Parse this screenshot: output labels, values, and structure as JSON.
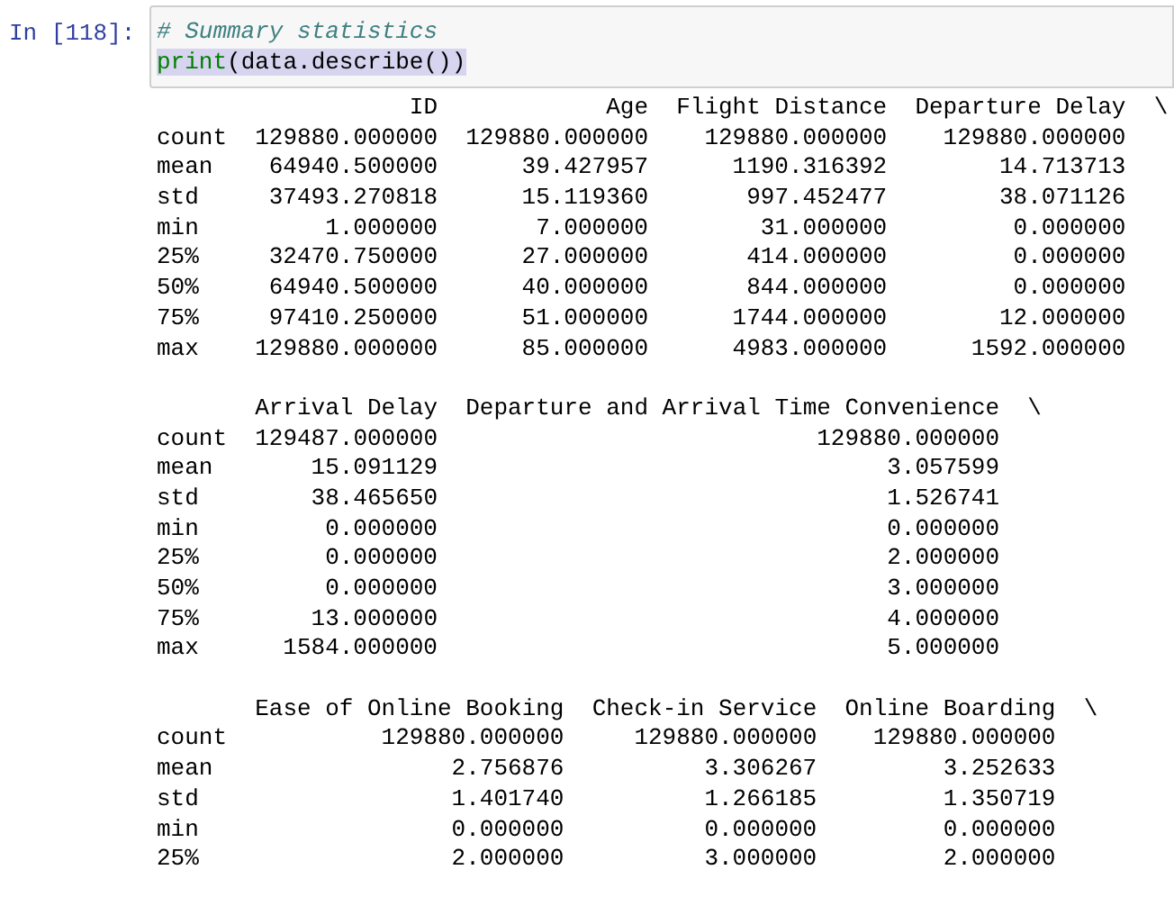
{
  "cell": {
    "prompt": "In [118]:",
    "lines": [
      {
        "highlighted": false,
        "tokens": [
          {
            "kind": "comment",
            "text": "# Summary statistics"
          }
        ]
      },
      {
        "highlighted": true,
        "tokens": [
          {
            "kind": "builtin",
            "text": "print"
          },
          {
            "kind": "plain",
            "text": "(data.describe())"
          }
        ]
      }
    ]
  },
  "output": {
    "tables": [
      {
        "index": [
          "count",
          "mean",
          "std",
          "min",
          "25%",
          "50%",
          "75%",
          "max"
        ],
        "continued": "\\",
        "columns": [
          {
            "name": "ID",
            "values": [
              "129880.000000",
              "64940.500000",
              "37493.270818",
              "1.000000",
              "32470.750000",
              "64940.500000",
              "97410.250000",
              "129880.000000"
            ]
          },
          {
            "name": "Age",
            "values": [
              "129880.000000",
              "39.427957",
              "15.119360",
              "7.000000",
              "27.000000",
              "40.000000",
              "51.000000",
              "85.000000"
            ]
          },
          {
            "name": "Flight Distance",
            "values": [
              "129880.000000",
              "1190.316392",
              "997.452477",
              "31.000000",
              "414.000000",
              "844.000000",
              "1744.000000",
              "4983.000000"
            ]
          },
          {
            "name": "Departure Delay",
            "values": [
              "129880.000000",
              "14.713713",
              "38.071126",
              "0.000000",
              "0.000000",
              "0.000000",
              "12.000000",
              "1592.000000"
            ]
          }
        ]
      },
      {
        "index": [
          "count",
          "mean",
          "std",
          "min",
          "25%",
          "50%",
          "75%",
          "max"
        ],
        "continued": "\\",
        "columns": [
          {
            "name": "Arrival Delay",
            "values": [
              "129487.000000",
              "15.091129",
              "38.465650",
              "0.000000",
              "0.000000",
              "0.000000",
              "13.000000",
              "1584.000000"
            ]
          },
          {
            "name": "Departure and Arrival Time Convenience",
            "values": [
              "129880.000000",
              "3.057599",
              "1.526741",
              "0.000000",
              "2.000000",
              "3.000000",
              "4.000000",
              "5.000000"
            ]
          }
        ]
      },
      {
        "index": [
          "count",
          "mean",
          "std",
          "min",
          "25%"
        ],
        "continued": "\\",
        "columns": [
          {
            "name": "Ease of Online Booking",
            "values": [
              "129880.000000",
              "2.756876",
              "1.401740",
              "0.000000",
              "2.000000"
            ]
          },
          {
            "name": "Check-in Service",
            "values": [
              "129880.000000",
              "3.306267",
              "1.266185",
              "0.000000",
              "3.000000"
            ]
          },
          {
            "name": "Online Boarding",
            "values": [
              "129880.000000",
              "3.252633",
              "1.350719",
              "0.000000",
              "2.000000"
            ]
          }
        ]
      }
    ]
  }
}
